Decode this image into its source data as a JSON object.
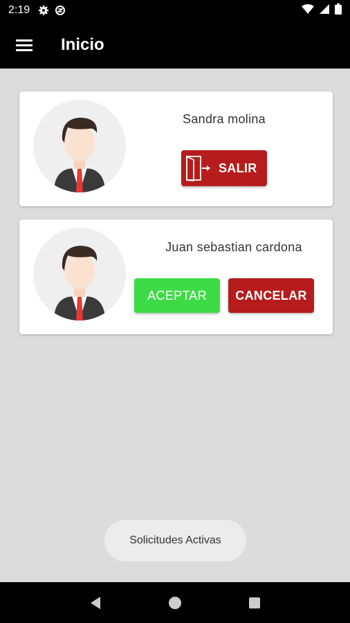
{
  "status_bar": {
    "time": "2:19"
  },
  "app_bar": {
    "title": "Inicio"
  },
  "requests": [
    {
      "name": "Sandra molina",
      "action_label": "SALIR"
    },
    {
      "name": "Juan sebastian cardona",
      "accept_label": "ACEPTAR",
      "cancel_label": "CANCELAR"
    }
  ],
  "footer": {
    "active_requests_label": "Solicitudes Activas"
  },
  "colors": {
    "primary_red": "#b71c1c",
    "accept_green": "#3ddc46",
    "app_bar": "#000000",
    "background": "#dcdcdc"
  }
}
